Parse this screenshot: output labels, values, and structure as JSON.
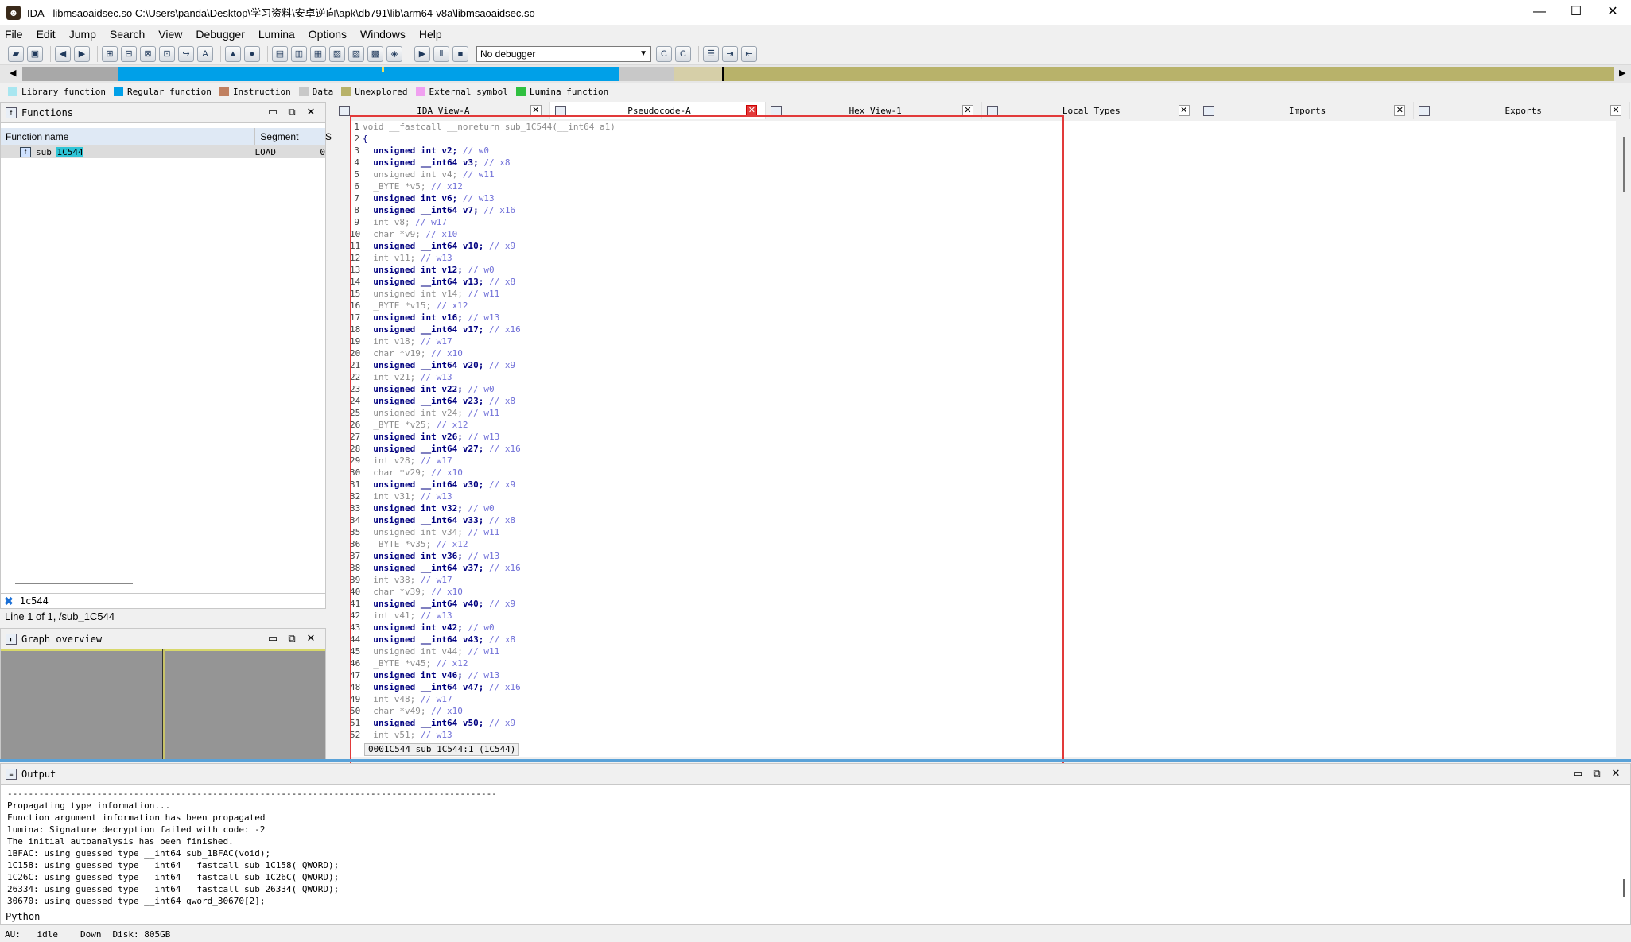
{
  "window": {
    "title": "IDA - libmsaoaidsec.so C:\\Users\\panda\\Desktop\\学习资料\\安卓逆向\\apk\\db791\\lib\\arm64-v8a\\libmsaoaidsec.so",
    "logo": "ida-logo",
    "min": "—",
    "max": "☐",
    "close": "✕"
  },
  "menu": [
    "File",
    "Edit",
    "Jump",
    "Search",
    "View",
    "Debugger",
    "Lumina",
    "Options",
    "Windows",
    "Help"
  ],
  "toolbar": {
    "debugger_select": "No debugger"
  },
  "legend": [
    {
      "label": "Library function",
      "color": "#a8e6f0"
    },
    {
      "label": "Regular function",
      "color": "#00a0e8"
    },
    {
      "label": "Instruction",
      "color": "#c08060"
    },
    {
      "label": "Data",
      "color": "#c8c8c8"
    },
    {
      "label": "Unexplored",
      "color": "#b8b26a"
    },
    {
      "label": "External symbol",
      "color": "#f0a0f0"
    },
    {
      "label": "Lumina function",
      "color": "#30c040"
    }
  ],
  "functions": {
    "title": "Functions",
    "col_name": "Function name",
    "col_segment": "Segment",
    "col_extra": "S",
    "rows": [
      {
        "name_prefix": "sub_",
        "name_highlight": "1C544",
        "segment": "LOAD",
        "extra": "0"
      }
    ],
    "filter": "1c544",
    "status": "Line 1 of 1, /sub_1C544"
  },
  "graph": {
    "title": "Graph overview"
  },
  "tabs": [
    {
      "label": "IDA View-A",
      "active": false,
      "close": "✕"
    },
    {
      "label": "Pseudocode-A",
      "active": true,
      "close": "✕"
    },
    {
      "label": "Hex View-1",
      "active": false,
      "close": "✕"
    },
    {
      "label": "Local Types",
      "active": false,
      "close": "✕"
    },
    {
      "label": "Imports",
      "active": false,
      "close": "✕"
    },
    {
      "label": "Exports",
      "active": false,
      "close": "✕"
    }
  ],
  "code": {
    "lines": [
      {
        "n": "1",
        "t": "void __fastcall __noreturn sub_1C544(__int64 a1)",
        "c": "gr"
      },
      {
        "n": "2",
        "t": "{",
        "c": "pl"
      },
      {
        "n": "3",
        "decl": "unsigned int v2;",
        "cm": "// w0",
        "c": "kw"
      },
      {
        "n": "4",
        "decl": "unsigned __int64 v3;",
        "cm": "// x8",
        "c": "kw"
      },
      {
        "n": "5",
        "decl": "unsigned int v4;",
        "cm": "// w11",
        "c": "gr"
      },
      {
        "n": "6",
        "decl": "_BYTE *v5;",
        "cm": "// x12",
        "c": "gr"
      },
      {
        "n": "7",
        "decl": "unsigned int v6;",
        "cm": "// w13",
        "c": "kw"
      },
      {
        "n": "8",
        "decl": "unsigned __int64 v7;",
        "cm": "// x16",
        "c": "kw"
      },
      {
        "n": "9",
        "decl": "int v8;",
        "cm": "// w17",
        "c": "gr"
      },
      {
        "n": "10",
        "decl": "char *v9;",
        "cm": "// x10",
        "c": "gr"
      },
      {
        "n": "11",
        "decl": "unsigned __int64 v10;",
        "cm": "// x9",
        "c": "kw"
      },
      {
        "n": "12",
        "decl": "int v11;",
        "cm": "// w13",
        "c": "gr"
      },
      {
        "n": "13",
        "decl": "unsigned int v12;",
        "cm": "// w0",
        "c": "kw"
      },
      {
        "n": "14",
        "decl": "unsigned __int64 v13;",
        "cm": "// x8",
        "c": "kw"
      },
      {
        "n": "15",
        "decl": "unsigned int v14;",
        "cm": "// w11",
        "c": "gr"
      },
      {
        "n": "16",
        "decl": "_BYTE *v15;",
        "cm": "// x12",
        "c": "gr"
      },
      {
        "n": "17",
        "decl": "unsigned int v16;",
        "cm": "// w13",
        "c": "kw"
      },
      {
        "n": "18",
        "decl": "unsigned __int64 v17;",
        "cm": "// x16",
        "c": "kw"
      },
      {
        "n": "19",
        "decl": "int v18;",
        "cm": "// w17",
        "c": "gr"
      },
      {
        "n": "20",
        "decl": "char *v19;",
        "cm": "// x10",
        "c": "gr"
      },
      {
        "n": "21",
        "decl": "unsigned __int64 v20;",
        "cm": "// x9",
        "c": "kw"
      },
      {
        "n": "22",
        "decl": "int v21;",
        "cm": "// w13",
        "c": "gr"
      },
      {
        "n": "23",
        "decl": "unsigned int v22;",
        "cm": "// w0",
        "c": "kw"
      },
      {
        "n": "24",
        "decl": "unsigned __int64 v23;",
        "cm": "// x8",
        "c": "kw"
      },
      {
        "n": "25",
        "decl": "unsigned int v24;",
        "cm": "// w11",
        "c": "gr"
      },
      {
        "n": "26",
        "decl": "_BYTE *v25;",
        "cm": "// x12",
        "c": "gr"
      },
      {
        "n": "27",
        "decl": "unsigned int v26;",
        "cm": "// w13",
        "c": "kw"
      },
      {
        "n": "28",
        "decl": "unsigned __int64 v27;",
        "cm": "// x16",
        "c": "kw"
      },
      {
        "n": "29",
        "decl": "int v28;",
        "cm": "// w17",
        "c": "gr"
      },
      {
        "n": "30",
        "decl": "char *v29;",
        "cm": "// x10",
        "c": "gr"
      },
      {
        "n": "31",
        "decl": "unsigned __int64 v30;",
        "cm": "// x9",
        "c": "kw"
      },
      {
        "n": "32",
        "decl": "int v31;",
        "cm": "// w13",
        "c": "gr"
      },
      {
        "n": "33",
        "decl": "unsigned int v32;",
        "cm": "// w0",
        "c": "kw"
      },
      {
        "n": "34",
        "decl": "unsigned __int64 v33;",
        "cm": "// x8",
        "c": "kw"
      },
      {
        "n": "35",
        "decl": "unsigned int v34;",
        "cm": "// w11",
        "c": "gr"
      },
      {
        "n": "36",
        "decl": "_BYTE *v35;",
        "cm": "// x12",
        "c": "gr"
      },
      {
        "n": "37",
        "decl": "unsigned int v36;",
        "cm": "// w13",
        "c": "kw"
      },
      {
        "n": "38",
        "decl": "unsigned __int64 v37;",
        "cm": "// x16",
        "c": "kw"
      },
      {
        "n": "39",
        "decl": "int v38;",
        "cm": "// w17",
        "c": "gr"
      },
      {
        "n": "40",
        "decl": "char *v39;",
        "cm": "// x10",
        "c": "gr"
      },
      {
        "n": "41",
        "decl": "unsigned __int64 v40;",
        "cm": "// x9",
        "c": "kw"
      },
      {
        "n": "42",
        "decl": "int v41;",
        "cm": "// w13",
        "c": "gr"
      },
      {
        "n": "43",
        "decl": "unsigned int v42;",
        "cm": "// w0",
        "c": "kw"
      },
      {
        "n": "44",
        "decl": "unsigned __int64 v43;",
        "cm": "// x8",
        "c": "kw"
      },
      {
        "n": "45",
        "decl": "unsigned int v44;",
        "cm": "// w11",
        "c": "gr"
      },
      {
        "n": "46",
        "decl": "_BYTE *v45;",
        "cm": "// x12",
        "c": "gr"
      },
      {
        "n": "47",
        "decl": "unsigned int v46;",
        "cm": "// w13",
        "c": "kw"
      },
      {
        "n": "48",
        "decl": "unsigned __int64 v47;",
        "cm": "// x16",
        "c": "kw"
      },
      {
        "n": "49",
        "decl": "int v48;",
        "cm": "// w17",
        "c": "gr"
      },
      {
        "n": "50",
        "decl": "char *v49;",
        "cm": "// x10",
        "c": "gr"
      },
      {
        "n": "51",
        "decl": "unsigned __int64 v50;",
        "cm": "// x9",
        "c": "kw"
      },
      {
        "n": "52",
        "decl": "int v51;",
        "cm": "// w13",
        "c": "gr"
      }
    ],
    "status": "0001C544 sub_1C544:1 (1C544)"
  },
  "output": {
    "title": "Output",
    "lines": [
      "---------------------------------------------------------------------------------------------",
      "Propagating type information...",
      "Function argument information has been propagated",
      "lumina: Signature decryption failed with code: -2",
      "The initial autoanalysis has been finished.",
      "1BFAC: using guessed type __int64 sub_1BFAC(void);",
      "1C158: using guessed type __int64 __fastcall sub_1C158(_QWORD);",
      "1C26C: using guessed type __int64 __fastcall sub_1C26C(_QWORD);",
      "26334: using guessed type __int64 __fastcall sub_26334(_QWORD);",
      "30670: using guessed type __int64 qword_30670[2];"
    ],
    "python_label": "Python"
  },
  "status": {
    "au": "AU:",
    "state": "idle",
    "dir": "Down",
    "disk": "Disk: 805GB"
  }
}
